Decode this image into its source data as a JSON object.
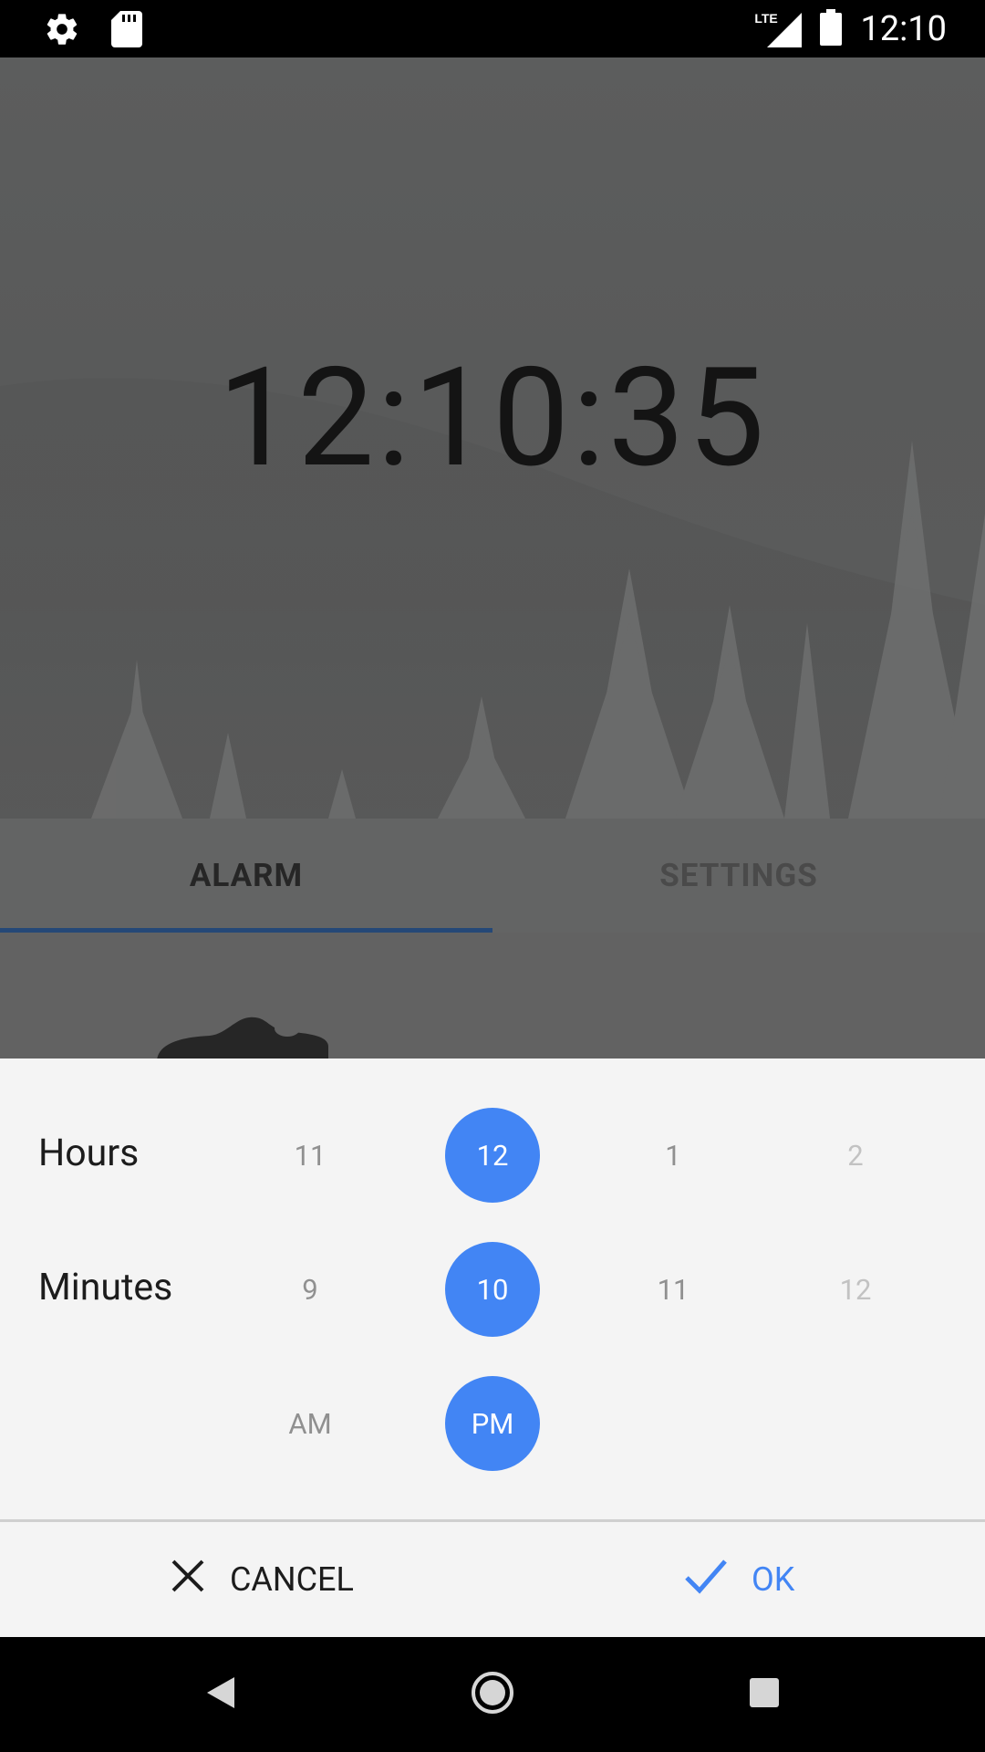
{
  "status_bar": {
    "time": "12:10",
    "icons": [
      "settings-icon",
      "sd-card-icon",
      "lte-signal-icon",
      "battery-icon"
    ],
    "lte_label": "LTE"
  },
  "clock": {
    "time": "12:10:35"
  },
  "tabs": [
    {
      "label": "ALARM",
      "active": true
    },
    {
      "label": "SETTINGS",
      "active": false
    }
  ],
  "picker": {
    "hours": {
      "label": "Hours",
      "options": [
        "11",
        "12",
        "1",
        "2"
      ],
      "selected": "12"
    },
    "minutes": {
      "label": "Minutes",
      "options": [
        "9",
        "10",
        "11",
        "12"
      ],
      "selected": "10"
    },
    "period": {
      "options": [
        "AM",
        "PM"
      ],
      "selected": "PM"
    }
  },
  "actions": {
    "cancel_label": "CANCEL",
    "ok_label": "OK"
  },
  "colors": {
    "accent": "#4285f4",
    "tab_indicator": "#254877",
    "sheet_background": "#f4f4f4"
  },
  "nav_bar": {
    "icons": [
      "back-icon",
      "home-icon",
      "recents-icon"
    ]
  }
}
